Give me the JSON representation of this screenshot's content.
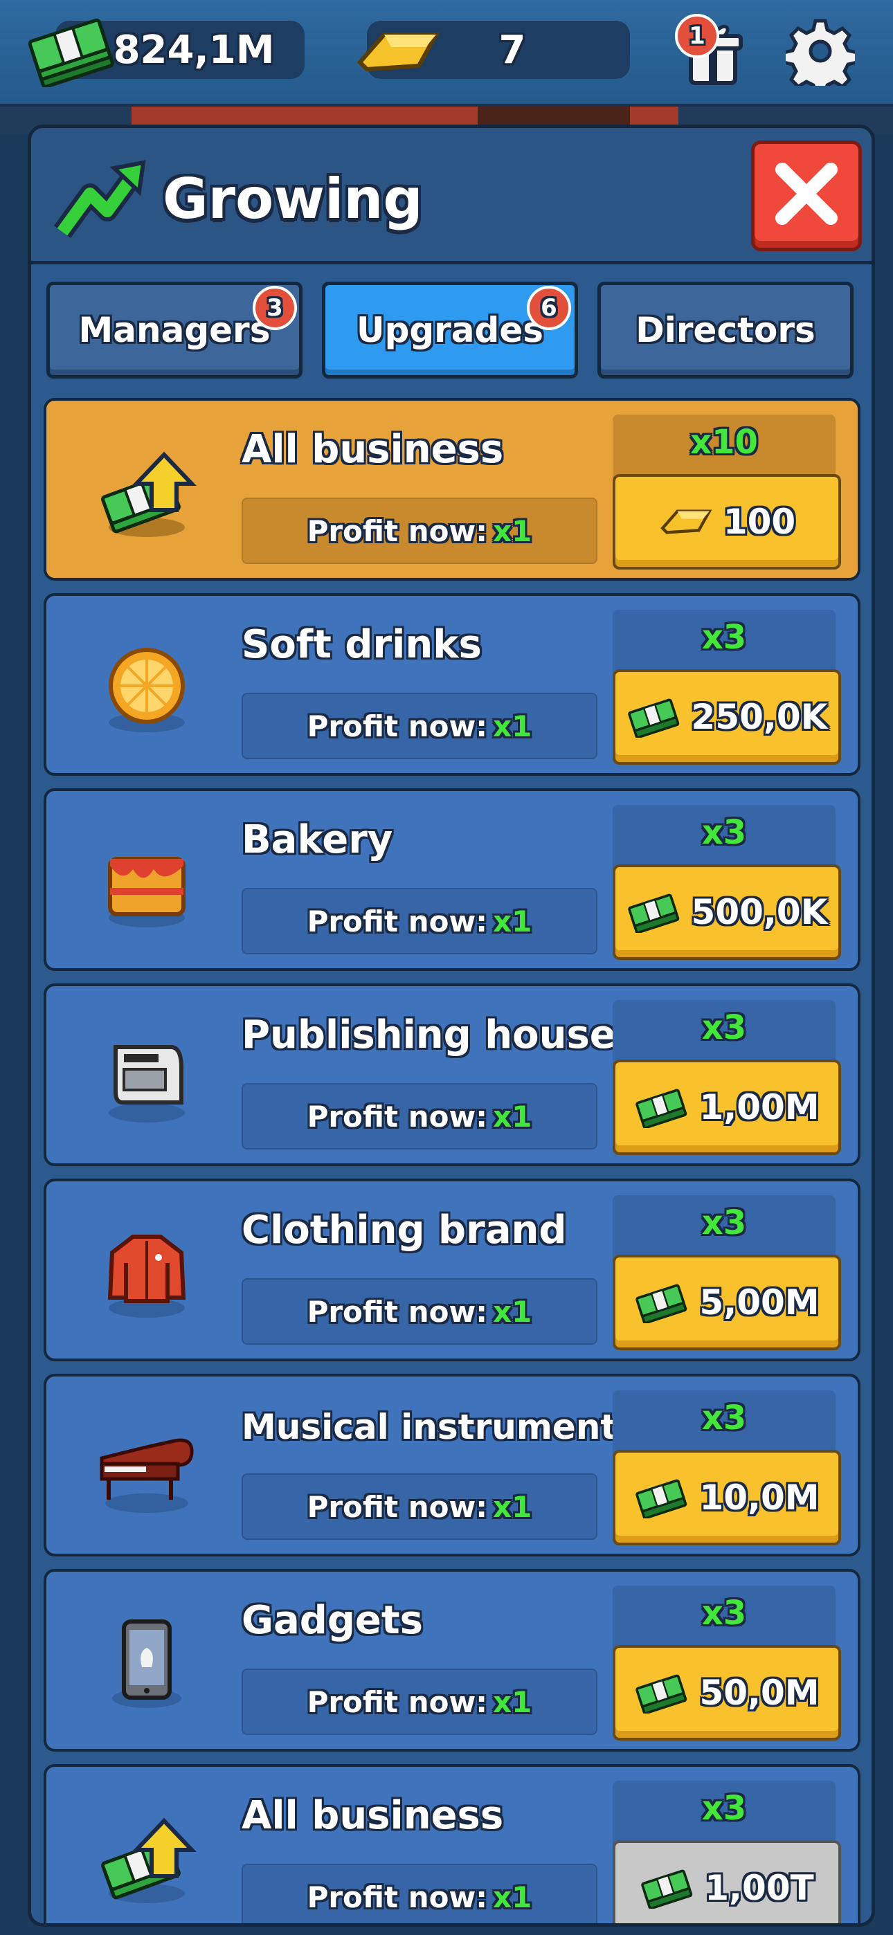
{
  "topbar": {
    "cash": "824,1M",
    "gold": "7",
    "gift_badge": "1"
  },
  "panel": {
    "title": "Growing",
    "tabs": [
      {
        "label": "Managers",
        "badge": "3"
      },
      {
        "label": "Upgrades",
        "badge": "6"
      },
      {
        "label": "Directors"
      }
    ],
    "profit_label": "Profit now:",
    "profit_value": "x1",
    "upgrades": [
      {
        "name": "All business",
        "multiplier": "x10",
        "price": "100",
        "currency": "gold"
      },
      {
        "name": "Soft drinks",
        "multiplier": "x3",
        "price": "250,0K",
        "currency": "cash"
      },
      {
        "name": "Bakery",
        "multiplier": "x3",
        "price": "500,0K",
        "currency": "cash"
      },
      {
        "name": "Publishing house",
        "multiplier": "x3",
        "price": "1,00M",
        "currency": "cash"
      },
      {
        "name": "Clothing brand",
        "multiplier": "x3",
        "price": "5,00M",
        "currency": "cash"
      },
      {
        "name": "Musical instruments",
        "multiplier": "x3",
        "price": "10,0M",
        "currency": "cash"
      },
      {
        "name": "Gadgets",
        "multiplier": "x3",
        "price": "50,0M",
        "currency": "cash"
      },
      {
        "name": "All business",
        "multiplier": "x3",
        "price": "1,00T",
        "currency": "cash"
      }
    ]
  },
  "colors": {
    "accent_green": "#43e63a",
    "gold_card": "#e7a23a",
    "blue_card": "#3f74bd",
    "buy_button": "#f9c12c",
    "close_button": "#f0483a",
    "active_tab": "#2f9bf0"
  },
  "icons": {
    "cash": "cash-stack-icon",
    "gold": "gold-bar-icon",
    "gift": "gift-icon",
    "settings": "gear-icon",
    "title": "growth-arrow-icon",
    "close": "close-icon"
  }
}
